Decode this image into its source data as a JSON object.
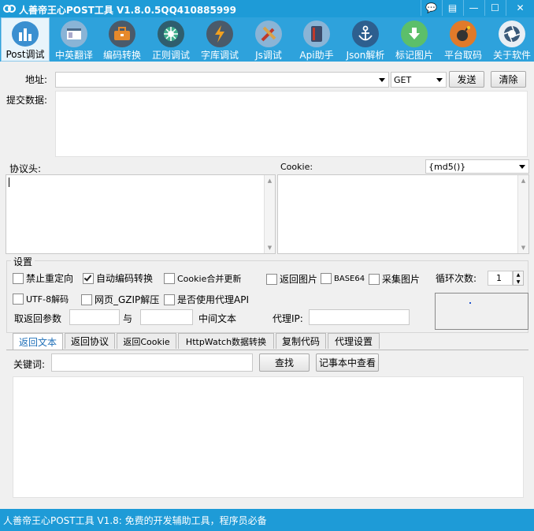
{
  "window": {
    "title": "人善帝王心POST工具 V1.8.0.5QQ410885999",
    "buttons": [
      "💬",
      "▤",
      "—",
      "☐",
      "✕"
    ]
  },
  "toolbar": {
    "items": [
      {
        "label": "Post调试",
        "icon": "bar-chart-icon",
        "color": "#3a8fd0",
        "active": true
      },
      {
        "label": "中英翻译",
        "icon": "window-icon",
        "color": "#8ab4d6"
      },
      {
        "label": "编码转换",
        "icon": "briefcase-icon",
        "color": "#e6892b"
      },
      {
        "label": "正则调试",
        "icon": "aperture-icon",
        "color": "#3fae8c"
      },
      {
        "label": "字库调试",
        "icon": "lightning-icon",
        "color": "#4a5a6a"
      },
      {
        "label": "Js调试",
        "icon": "tools-icon",
        "color": "#d9a24a"
      },
      {
        "label": "Api助手",
        "icon": "book-icon",
        "color": "#3a4a6a"
      },
      {
        "label": "Json解析",
        "icon": "anchor-icon",
        "color": "#2d5f8f"
      },
      {
        "label": "标记图片",
        "icon": "download-icon",
        "color": "#5cbf6a"
      },
      {
        "label": "平台取码",
        "icon": "bomb-icon",
        "color": "#e07a2a"
      },
      {
        "label": "关于软件",
        "icon": "camera-shutter-icon",
        "color": "#3a5a7a"
      }
    ]
  },
  "form": {
    "address_label": "地址:",
    "address_value": "",
    "method_value": "GET",
    "send_label": "发送",
    "clear_label": "清除",
    "post_data_label": "提交数据:",
    "header_label": "协议头:",
    "cookie_label": "Cookie:",
    "hash_select_value": "{md5()}"
  },
  "settings": {
    "group_label": "设置",
    "checkboxes": [
      {
        "label": "禁止重定向",
        "checked": false
      },
      {
        "label": "自动编码转换",
        "checked": true
      },
      {
        "label": "Cookie合并更新",
        "checked": false
      },
      {
        "label": "返回图片",
        "checked": false
      },
      {
        "label": "BASE64",
        "checked": false
      },
      {
        "label": "采集图片",
        "checked": false
      },
      {
        "label": "UTF-8解码",
        "checked": false
      },
      {
        "label": "网页_GZIP解压",
        "checked": false
      },
      {
        "label": "是否使用代理API",
        "checked": false
      }
    ],
    "loop_label": "循环次数:",
    "loop_value": "1",
    "extract_label": "取返回参数",
    "and_label": "与",
    "middle_text_label": "中间文本",
    "proxy_ip_label": "代理IP:"
  },
  "tabs": [
    "返回文本",
    "返回协议",
    "返回Cookie",
    "HttpWatch数据转换",
    "复制代码",
    "代理设置"
  ],
  "result": {
    "keyword_label": "关键词:",
    "find_label": "查找",
    "notepad_label": "记事本中查看"
  },
  "status": {
    "text": "人善帝王心POST工具 V1.8: 免费的开发辅助工具，程序员必备"
  }
}
